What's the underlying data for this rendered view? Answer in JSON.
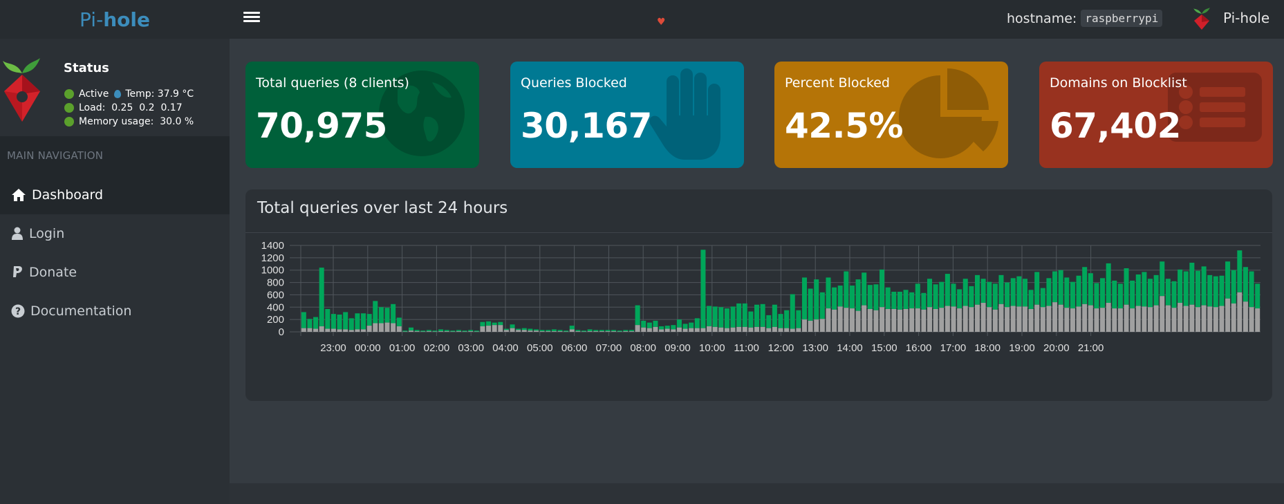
{
  "header": {
    "brand_light": "Pi-",
    "brand_bold": "hole",
    "hostname_label": "hostname:",
    "hostname_value": "raspberrypi",
    "user_label": "Pi-hole"
  },
  "sidebar": {
    "status_title": "Status",
    "status_active": "Active",
    "status_temp": "Temp: 37.9 °C",
    "status_load": "Load:  0.25  0.2  0.17",
    "status_memory": "Memory usage:  30.0 %",
    "nav_header": "MAIN NAVIGATION",
    "items": [
      {
        "label": "Dashboard",
        "icon": "home-icon"
      },
      {
        "label": "Login",
        "icon": "user-icon"
      },
      {
        "label": "Donate",
        "icon": "paypal-icon"
      },
      {
        "label": "Documentation",
        "icon": "question-circle-icon"
      }
    ]
  },
  "cards": [
    {
      "label": "Total queries (8 clients)",
      "value": "70,975",
      "icon": "globe-icon",
      "color": "#00603a"
    },
    {
      "label": "Queries Blocked",
      "value": "30,167",
      "icon": "hand-icon",
      "color": "#007993"
    },
    {
      "label": "Percent Blocked",
      "value": "42.5%",
      "icon": "pie-chart-icon",
      "color": "#b57407"
    },
    {
      "label": "Domains on Blocklist",
      "value": "67,402",
      "icon": "list-icon",
      "color": "#98321f"
    }
  ],
  "chart": {
    "title": "Total queries over last 24 hours"
  },
  "chart_data": {
    "type": "bar",
    "stacked": true,
    "ylim": [
      0,
      1400
    ],
    "yticks": [
      "0",
      "200",
      "400",
      "600",
      "800",
      "1000",
      "1200",
      "1400"
    ],
    "xticks": [
      "23:00",
      "00:00",
      "01:00",
      "02:00",
      "03:00",
      "04:00",
      "05:00",
      "06:00",
      "07:00",
      "08:00",
      "09:00",
      "10:00",
      "11:00",
      "12:00",
      "13:00",
      "14:00",
      "15:00",
      "16:00",
      "17:00",
      "18:00",
      "19:00",
      "20:00",
      "21:00"
    ],
    "colors": {
      "permitted": "#00a65a",
      "blocked": "#a0a0a0"
    },
    "totals": [
      320,
      210,
      240,
      1040,
      370,
      290,
      280,
      320,
      220,
      300,
      300,
      290,
      500,
      400,
      390,
      450,
      230,
      20,
      70,
      30,
      20,
      30,
      20,
      40,
      30,
      20,
      30,
      20,
      30,
      20,
      160,
      170,
      150,
      160,
      50,
      120,
      50,
      60,
      50,
      40,
      30,
      30,
      40,
      30,
      20,
      100,
      30,
      20,
      40,
      30,
      30,
      30,
      30,
      20,
      30,
      30,
      430,
      180,
      150,
      180,
      90,
      100,
      110,
      200,
      130,
      150,
      220,
      1330,
      420,
      410,
      400,
      380,
      410,
      460,
      460,
      330,
      440,
      450,
      270,
      440,
      290,
      350,
      610,
      350,
      880,
      700,
      850,
      640,
      880,
      720,
      750,
      980,
      750,
      850,
      960,
      760,
      770,
      1010,
      720,
      650,
      650,
      680,
      640,
      780,
      630,
      860,
      770,
      810,
      940,
      780,
      690,
      860,
      740,
      920,
      860,
      810,
      780,
      920,
      800,
      870,
      900,
      860,
      680,
      970,
      710,
      870,
      980,
      1000,
      880,
      810,
      910,
      1050,
      950,
      790,
      870,
      1110,
      830,
      780,
      1030,
      830,
      930,
      970,
      860,
      920,
      1140,
      860,
      820,
      1010,
      980,
      1120,
      990,
      1060,
      920,
      900,
      910,
      1140,
      1000,
      1320,
      1050,
      980,
      780
    ],
    "blocked": [
      60,
      60,
      50,
      90,
      50,
      50,
      40,
      40,
      30,
      40,
      40,
      100,
      140,
      140,
      150,
      140,
      90,
      5,
      20,
      10,
      5,
      10,
      5,
      10,
      10,
      5,
      10,
      5,
      10,
      5,
      90,
      100,
      110,
      110,
      30,
      60,
      30,
      30,
      20,
      20,
      10,
      10,
      10,
      10,
      5,
      40,
      10,
      5,
      10,
      10,
      10,
      10,
      10,
      5,
      10,
      10,
      110,
      70,
      60,
      80,
      40,
      50,
      40,
      70,
      50,
      60,
      60,
      60,
      90,
      80,
      70,
      60,
      70,
      80,
      80,
      70,
      80,
      80,
      60,
      80,
      60,
      60,
      50,
      60,
      200,
      180,
      200,
      210,
      380,
      360,
      410,
      390,
      380,
      340,
      430,
      370,
      350,
      400,
      370,
      370,
      360,
      370,
      380,
      380,
      360,
      400,
      370,
      390,
      420,
      410,
      380,
      420,
      400,
      440,
      470,
      400,
      360,
      450,
      400,
      420,
      410,
      410,
      370,
      440,
      400,
      420,
      480,
      440,
      390,
      380,
      410,
      450,
      430,
      380,
      390,
      470,
      380,
      380,
      440,
      380,
      420,
      410,
      400,
      430,
      580,
      430,
      390,
      470,
      420,
      440,
      400,
      430,
      410,
      400,
      420,
      540,
      460,
      640,
      490,
      400,
      380
    ]
  }
}
